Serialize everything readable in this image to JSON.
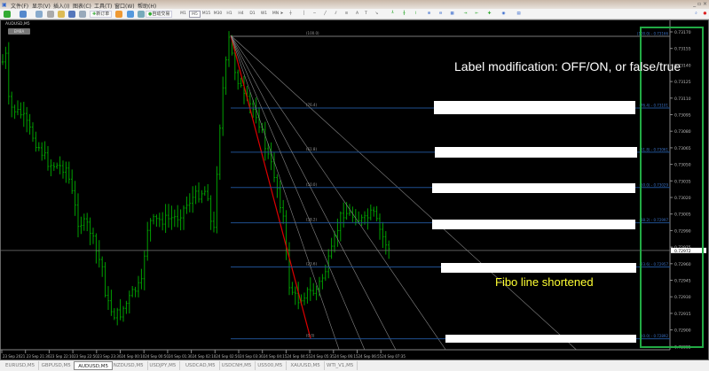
{
  "menu": [
    "文件(F)",
    "显示(V)",
    "插入(I)",
    "图表(C)",
    "工具(T)",
    "窗口(W)",
    "帮助(H)"
  ],
  "toolbar": {
    "new_order": "新订单",
    "auto_trading": "自动交易",
    "timeframes": [
      "M1",
      "M5",
      "M15",
      "M30",
      "H1",
      "H4",
      "D1",
      "W1",
      "MN"
    ],
    "active_timeframe": "M5"
  },
  "chart": {
    "title": "AUDUSD,M5",
    "button": "EMBA",
    "current_price": "0.72972",
    "price_axis": [
      "0.73170",
      "0.73155",
      "0.73140",
      "0.73125",
      "0.73110",
      "0.73095",
      "0.73080",
      "0.73065",
      "0.73050",
      "0.73035",
      "0.73020",
      "0.73005",
      "0.72990",
      "0.72975",
      "0.72960",
      "0.72945",
      "0.72930",
      "0.72915",
      "0.72900",
      "0.72885"
    ],
    "time_axis": [
      "23 Sep 2021",
      "23 Sep 21:30",
      "23 Sep 22:10",
      "23 Sep 22:50",
      "23 Sep 23:30",
      "24 Sep 00:10",
      "24 Sep 00:50",
      "24 Sep 01:30",
      "24 Sep 02:10",
      "24 Sep 02:50",
      "24 Sep 03:30",
      "24 Sep 04:15",
      "24 Sep 04:55",
      "24 Sep 05:35",
      "24 Sep 06:15",
      "24 Sep 06:55",
      "24 Sep 07:35"
    ],
    "fibo_levels": [
      {
        "level": "100.0",
        "price": "0.73166",
        "fan_label": "(100.0)",
        "right_label": "(100.0) - 0.73166"
      },
      {
        "level": "76.4",
        "price": "0.73101",
        "fan_label": "(76.4)",
        "right_label": "(76.4) - 0.73101"
      },
      {
        "level": "61.8",
        "price": "0.73061",
        "fan_label": "(61.8)",
        "right_label": "(61.8) - 0.73061"
      },
      {
        "level": "50.0",
        "price": "0.73029",
        "fan_label": "(50.0)",
        "right_label": "(50.0) - 0.73029"
      },
      {
        "level": "38.2",
        "price": "0.72997",
        "fan_label": "(38.2)",
        "right_label": "(38.2) - 0.72997"
      },
      {
        "level": "23.6",
        "price": "0.72957",
        "fan_label": "(23.6)",
        "right_label": "(23.6) - 0.72957"
      },
      {
        "level": "0.0",
        "price": "0.72892",
        "fan_label": "(0.0)",
        "right_label": "(0.0) - 0.72892"
      }
    ],
    "annotation_label_mod": "Label modification: OFF/ON, or false/true",
    "annotation_fibo": "Fibo line shortened",
    "colors": {
      "bars": "#00a000",
      "fibo_level": "#1f4f8f",
      "fan": "#888888",
      "trend": "#dd0000",
      "highlight_box": "#22aa44",
      "annotation_fibo": "#ffff33"
    }
  },
  "tabs": [
    "EURUSD,M5",
    "GBPUSD,M5",
    "AUDUSD,M5",
    "NZDUSD,M5",
    "USDJPY,M5",
    "USDCAD,M5",
    "USDCNH,M5",
    "US500,M5",
    "XAUUSD,M5",
    "WTI_V1,M5"
  ],
  "active_tab": "AUDUSD,M5"
}
